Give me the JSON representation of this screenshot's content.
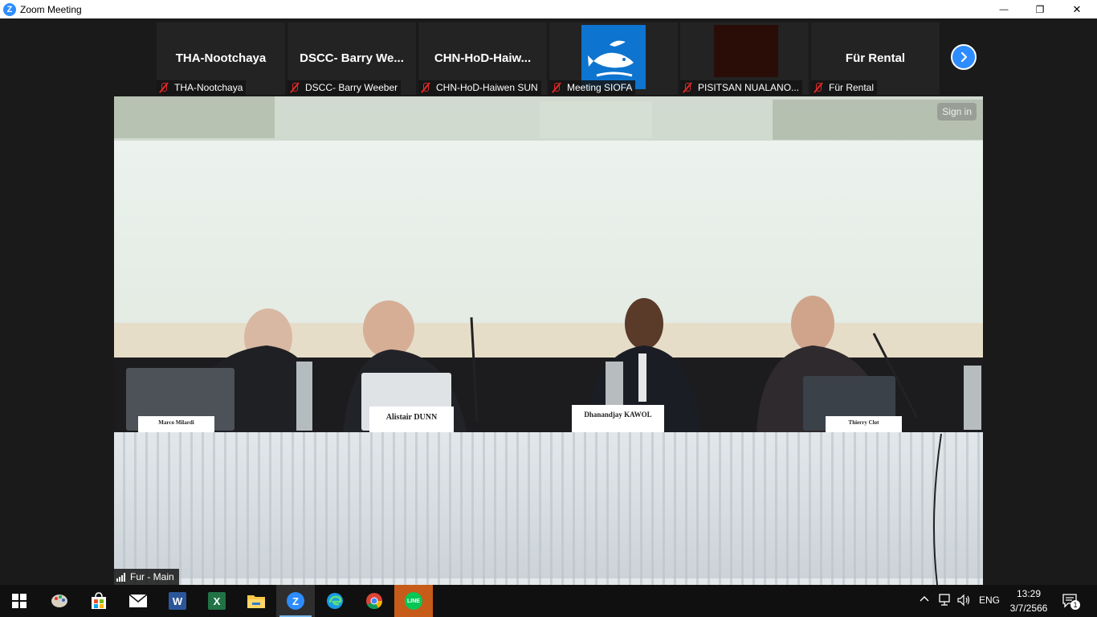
{
  "window": {
    "title": "Zoom Meeting",
    "minimize": "—",
    "restore": "❐",
    "close": "✕"
  },
  "thumbnails": [
    {
      "big_name": "THA-Nootchaya",
      "label": "THA-Nootchaya"
    },
    {
      "big_name": "DSCC- Barry We...",
      "label": "DSCC- Barry Weeber"
    },
    {
      "big_name": "CHN-HoD-Haiw...",
      "label": "CHN-HoD-Haiwen SUN"
    },
    {
      "big_name": "",
      "label": "Meeting SIOFA"
    },
    {
      "big_name": "",
      "label": "PISITSAN NUALANO..."
    },
    {
      "big_name": "Für Rental",
      "label": "Für Rental"
    }
  ],
  "main_video": {
    "sign_in": "Sign in",
    "speaker": "Fur - Main",
    "name_plates": [
      "Marco Milardi",
      "Alistair DUNN",
      "Dhanandjay KAWOL",
      "Thierry Clot"
    ]
  },
  "taskbar": {
    "language": "ENG",
    "time": "13:29",
    "date": "3/7/2566",
    "notification_count": "1",
    "word_letter": "W",
    "excel_letter": "X",
    "zoom_letter": "Z",
    "line_label": "LINE"
  },
  "colors": {
    "zoom_blue": "#2d8cff",
    "muted_red": "#e02828",
    "siofa_blue": "#0d74cf",
    "word_blue": "#2b579a",
    "excel_green": "#217346",
    "line_green": "#06c755"
  }
}
